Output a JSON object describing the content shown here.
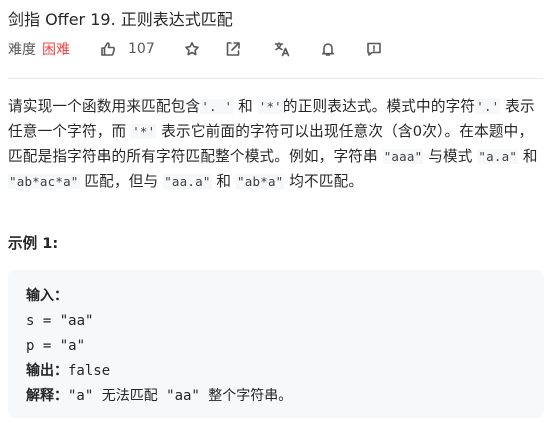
{
  "problem": {
    "title": "剑指 Offer 19. 正则表达式匹配",
    "difficulty_label": "难度",
    "difficulty": "困难",
    "like_count": "107"
  },
  "toolbar_icons": [
    "thumbs-up-icon",
    "star-icon",
    "share-icon",
    "translate-icon",
    "bell-icon",
    "feedback-icon"
  ],
  "description": {
    "p1_a": "请实现一个函数用来匹配包含",
    "code_dot": "'. '",
    "p1_b": "和",
    "code_star": "'*'",
    "p1_c": "的正则表达式。模式中的字符",
    "code_dot2": "'.'",
    "p1_d": "表示任意一个字符，而",
    "code_star2": "'*'",
    "p1_e": "表示它前面的字符可以出现任意次（含0次）。在本题中，匹配是指字符串的所有字符匹配整个模式。例如，字符串",
    "code_aaa": "\"aaa\"",
    "p1_f": "与模式",
    "code_a_a": "\"a.a\"",
    "p1_g": "和",
    "code_abacA": "\"ab*ac*a\"",
    "p1_h": "匹配，但与",
    "code_aa_a": "\"aa.a\"",
    "p1_i": "和",
    "code_abA": "\"ab*a\"",
    "p1_j": "均不匹配。"
  },
  "example": {
    "title": "示例 1:",
    "input_label": "输入：",
    "line_s": "s = \"aa\"",
    "line_p": "p = \"a\"",
    "output_label": "输出：",
    "output_value": "false",
    "explain_label": "解释：",
    "explain_value": "\"a\" 无法匹配 \"aa\" 整个字符串。"
  },
  "colors": {
    "difficulty_hard": "#ef4743",
    "example_bg": "#f7f8fa"
  }
}
